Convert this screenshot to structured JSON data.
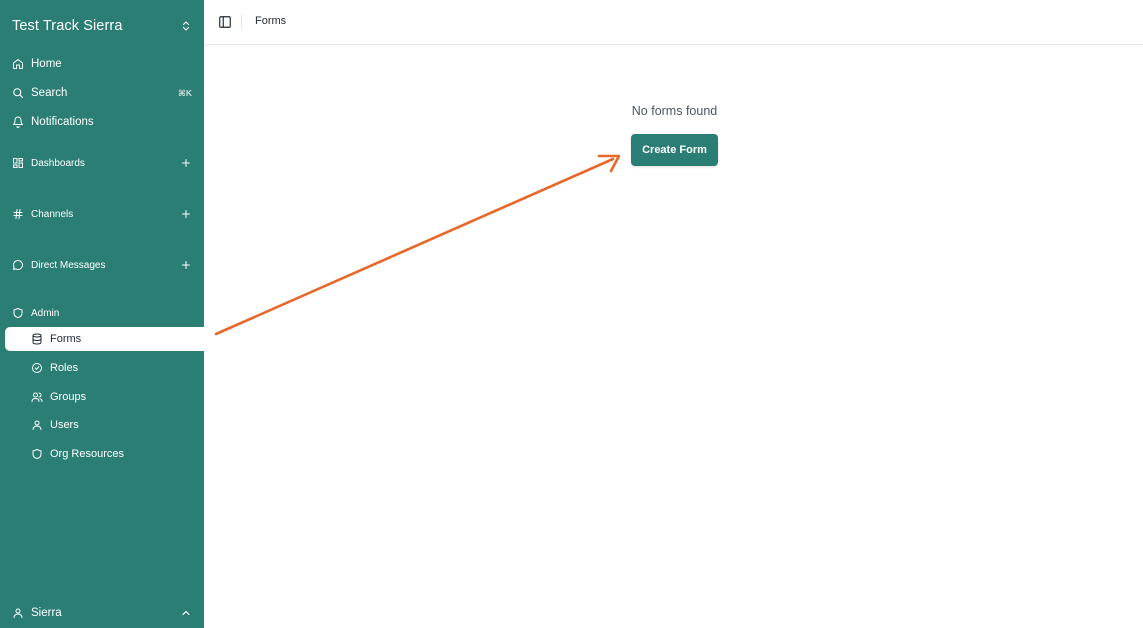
{
  "workspace": {
    "name": "Test Track Sierra"
  },
  "nav": {
    "home": "Home",
    "search": "Search",
    "search_shortcut": "⌘K",
    "notifications": "Notifications",
    "dashboards": "Dashboards",
    "channels": "Channels",
    "direct_messages": "Direct Messages",
    "admin": "Admin"
  },
  "admin_items": [
    "Forms",
    "Roles",
    "Groups",
    "Users",
    "Org Resources"
  ],
  "active_item": "Forms",
  "user": {
    "name": "Sierra"
  },
  "header": {
    "breadcrumb": "Forms"
  },
  "main": {
    "empty_message": "No forms found",
    "create_button": "Create Form"
  },
  "colors": {
    "sidebar": "#2b7e74",
    "accent": "#2b7e74",
    "annotation_arrow": "#e8672a"
  },
  "icons": {
    "home": "home-icon",
    "search": "search-icon",
    "notifications": "bell-icon",
    "dashboards": "grid-icon",
    "channels": "hash-icon",
    "direct_messages": "chat-icon",
    "admin": "shield-icon",
    "forms": "database-icon",
    "roles": "check-circle-icon",
    "groups": "users-icon",
    "users": "user-icon",
    "org_resources": "shield-icon"
  }
}
